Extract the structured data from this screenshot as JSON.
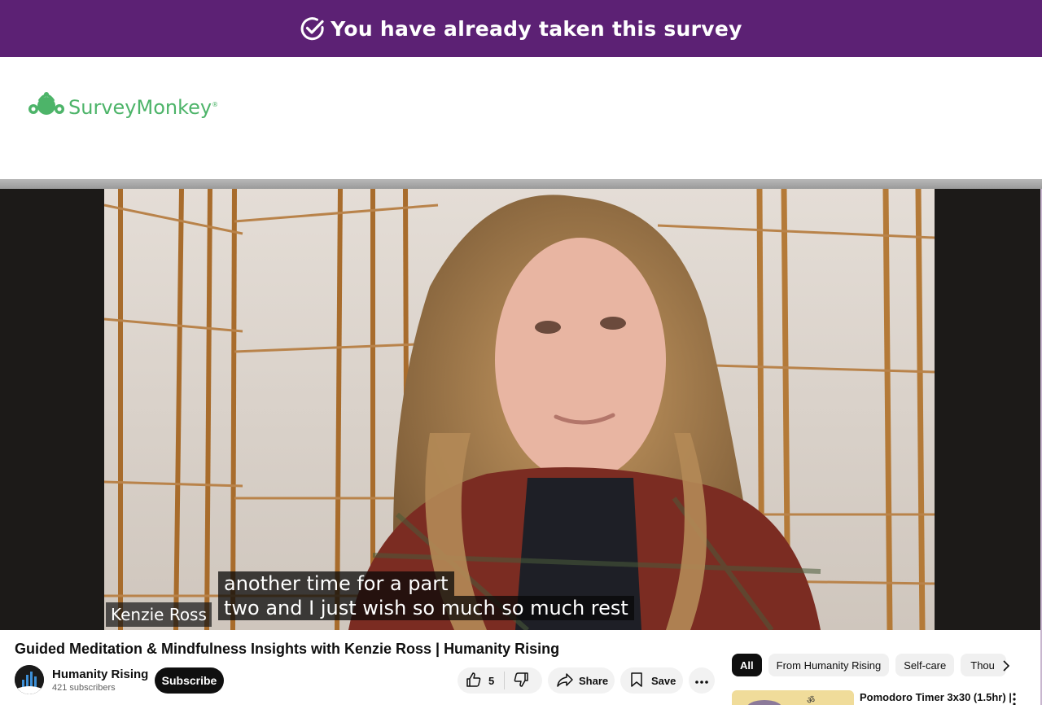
{
  "banner": {
    "text": "You have already taken this survey",
    "icon": "check-circle-icon",
    "color": "#5c2174"
  },
  "header": {
    "logo_text": "SurveyMonkey",
    "logo_registered": "®",
    "logo_color": "#4db469"
  },
  "video": {
    "captions": [
      "another time for a part",
      "two and I just wish so much so much rest"
    ],
    "name_tag": "Kenzie Ross"
  },
  "watch": {
    "title": "Guided Meditation & Mindfulness Insights with Kenzie Ross | Humanity Rising",
    "channel": {
      "name": "Humanity Rising",
      "subscribers": "421 subscribers"
    },
    "subscribe_label": "Subscribe",
    "likes": "5",
    "share_label": "Share",
    "save_label": "Save"
  },
  "chips": [
    "All",
    "From Humanity Rising",
    "Self-care",
    "Thou"
  ],
  "recommendation": {
    "title": "Pomodoro Timer 3x30 (1.5hr) |"
  }
}
